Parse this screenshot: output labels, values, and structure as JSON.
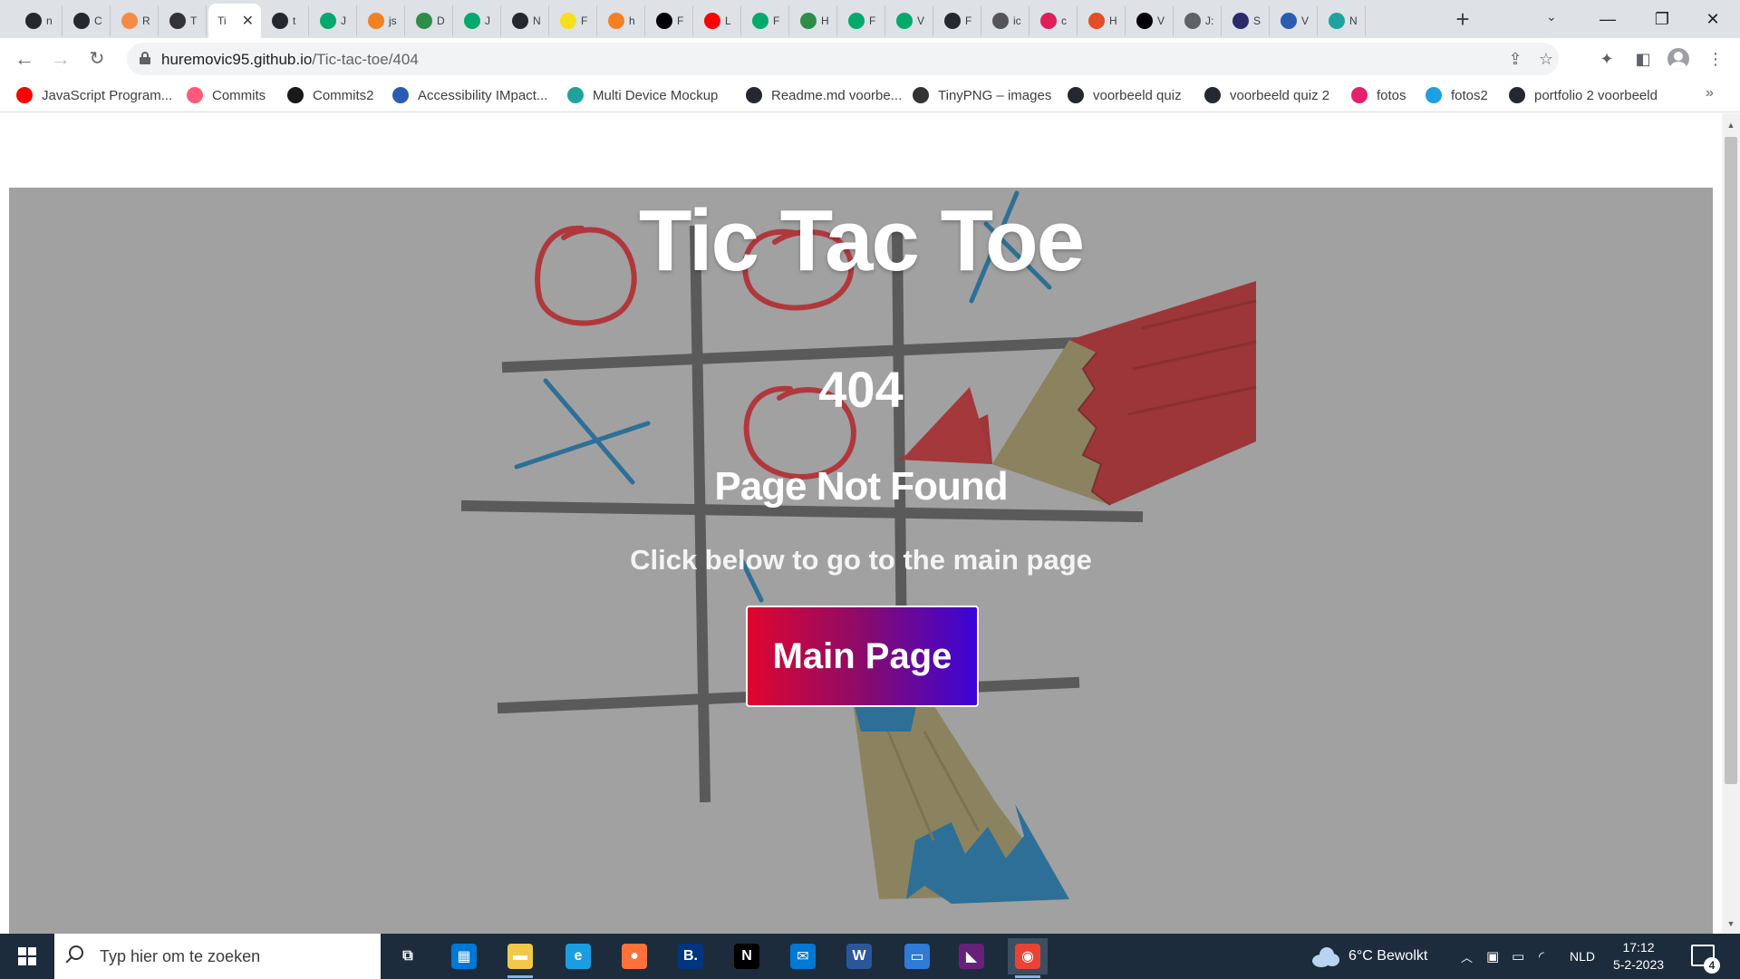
{
  "browser": {
    "tabs": [
      {
        "label": "n",
        "icon": "github-icon",
        "color": "#24292f"
      },
      {
        "label": "C",
        "icon": "github-icon",
        "color": "#24292f"
      },
      {
        "label": "R",
        "icon": "refresh-logo-icon",
        "color": "#f48c45"
      },
      {
        "label": "T",
        "icon": "hash-icon",
        "color": "#333333"
      },
      {
        "label": "Ti",
        "icon": "",
        "color": "#ffffff",
        "active": true
      },
      {
        "label": "t",
        "icon": "github-icon",
        "color": "#24292f"
      },
      {
        "label": "J",
        "icon": "w3schools-icon",
        "color": "#04aa6d"
      },
      {
        "label": "js",
        "icon": "stackoverflow-icon",
        "color": "#f48024"
      },
      {
        "label": "D",
        "icon": "geeksforgeeks-icon",
        "color": "#2f8d46"
      },
      {
        "label": "J",
        "icon": "w3schools-icon",
        "color": "#04aa6d"
      },
      {
        "label": "N",
        "icon": "github-icon",
        "color": "#24292f"
      },
      {
        "label": "F",
        "icon": "javascript-icon",
        "color": "#f7df1e"
      },
      {
        "label": "h",
        "icon": "stackoverflow-icon",
        "color": "#f48024"
      },
      {
        "label": "F",
        "icon": "medium-icon",
        "color": "#000000"
      },
      {
        "label": "L",
        "icon": "youtube-icon",
        "color": "#ff0000"
      },
      {
        "label": "F",
        "icon": "w3schools-icon",
        "color": "#04aa6d"
      },
      {
        "label": "H",
        "icon": "geeksforgeeks-icon",
        "color": "#2f8d46"
      },
      {
        "label": "F",
        "icon": "w3schools-icon",
        "color": "#04aa6d"
      },
      {
        "label": "V",
        "icon": "w3schools-icon",
        "color": "#04aa6d"
      },
      {
        "label": "F",
        "icon": "github-icon",
        "color": "#24292f"
      },
      {
        "label": "ic",
        "icon": "apple-icon",
        "color": "#555555"
      },
      {
        "label": "c",
        "icon": "slack-icon",
        "color": "#e01e5a"
      },
      {
        "label": "H",
        "icon": "w3c-icon",
        "color": "#e44d26"
      },
      {
        "label": "V",
        "icon": "codepen-icon",
        "color": "#000000"
      },
      {
        "label": "J:",
        "icon": "globe-icon",
        "color": "#5f6368"
      },
      {
        "label": "S",
        "icon": "hooks-icon",
        "color": "#2b2b6b"
      },
      {
        "label": "V",
        "icon": "webaim-icon",
        "color": "#2a5db0"
      },
      {
        "label": "N",
        "icon": "typescript-icon",
        "color": "#1fa29e"
      }
    ],
    "url_host": "huremovic95.github.io",
    "url_path": "/Tic-tac-toe/404",
    "bookmarks": [
      {
        "label": "JavaScript Program...",
        "icon": "youtube-icon",
        "color": "#ff0000"
      },
      {
        "label": "Commits",
        "icon": "commits-icon",
        "color": "#ff5a79"
      },
      {
        "label": "Commits2",
        "icon": "codecademy-icon",
        "color": "#1a1a1a"
      },
      {
        "label": "Accessibility IMpact...",
        "icon": "webaim-icon",
        "color": "#2a5db0"
      },
      {
        "label": "Multi Device Mockup",
        "icon": "typescript-icon",
        "color": "#1fa29e"
      },
      {
        "label": "Readme.md voorbe...",
        "icon": "github-icon",
        "color": "#24292f"
      },
      {
        "label": "TinyPNG – images",
        "icon": "panda-icon",
        "color": "#333333"
      },
      {
        "label": "voorbeeld quiz",
        "icon": "github-icon",
        "color": "#24292f"
      },
      {
        "label": "voorbeeld quiz 2",
        "icon": "github-icon",
        "color": "#24292f"
      },
      {
        "label": "fotos",
        "icon": "drop-icon",
        "color": "#e6206a"
      },
      {
        "label": "fotos2",
        "icon": "bird-icon",
        "color": "#1ba0e1"
      },
      {
        "label": "portfolio 2 voorbeeld",
        "icon": "github-icon",
        "color": "#24292f"
      }
    ]
  },
  "page": {
    "title": "Tic Tac Toe",
    "code": "404",
    "heading": "Page Not Found",
    "hint": "Click below to go to the main page",
    "button_label": "Main Page",
    "background_color": "#a1a1a1",
    "button_gradient": [
      "#e0062f",
      "#3a04d8"
    ]
  },
  "taskbar": {
    "search_placeholder": "Typ hier om te zoeken",
    "apps": [
      {
        "name": "task-view",
        "glyph": "⧉",
        "color": "#1c2c3c"
      },
      {
        "name": "microsoft-store",
        "glyph": "▦",
        "color": "#0078d4"
      },
      {
        "name": "file-explorer",
        "glyph": "▬",
        "color": "#f2c84b"
      },
      {
        "name": "edge",
        "glyph": "e",
        "color": "#1b9de2"
      },
      {
        "name": "firefox",
        "glyph": "●",
        "color": "#ff7139"
      },
      {
        "name": "booking",
        "glyph": "B.",
        "color": "#003580"
      },
      {
        "name": "netflix",
        "glyph": "N",
        "color": "#000000"
      },
      {
        "name": "mail",
        "glyph": "✉",
        "color": "#0078d4"
      },
      {
        "name": "word",
        "glyph": "W",
        "color": "#2b579a"
      },
      {
        "name": "whiteboard",
        "glyph": "▭",
        "color": "#2f7bd6"
      },
      {
        "name": "visual-studio",
        "glyph": "◣",
        "color": "#68217a"
      },
      {
        "name": "chrome",
        "glyph": "◉",
        "color": "#ea4335"
      }
    ],
    "weather": "6°C  Bewolkt",
    "language": "NLD",
    "time": "17:12",
    "date": "5-2-2023",
    "notifications": "4"
  }
}
